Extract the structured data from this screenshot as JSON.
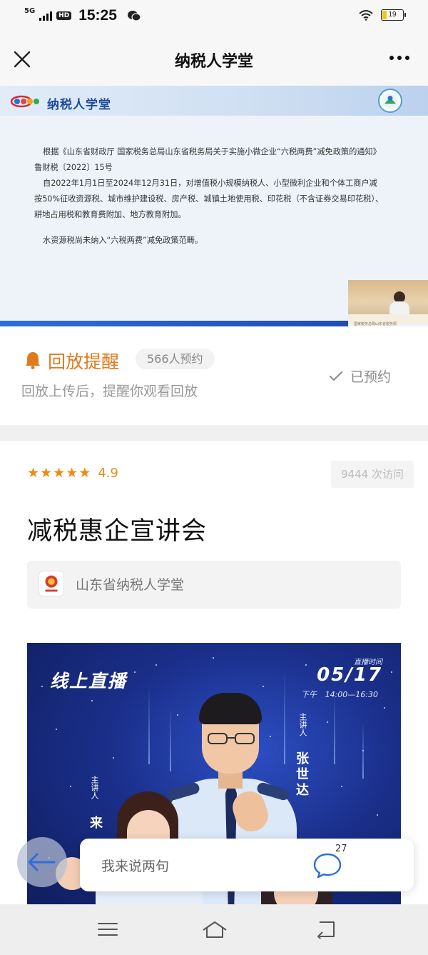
{
  "status_bar": {
    "network": "5G",
    "hd": "HD",
    "time": "15:25",
    "battery": "19",
    "battery_level": 0.19
  },
  "nav": {
    "title": "纳税人学堂"
  },
  "video": {
    "header_title": "纳税人学堂",
    "paragraph1": "根据《山东省财政厅 国家税务总局山东省税务局关于实施小微企业“六税两费”减免政策的通知》鲁财税〔2022〕15号",
    "paragraph2": "自2022年1月1日至2024年12月31日，对增值税小规模纳税人、小型微利企业和个体工商户减按50%征收资源税、城市维护建设税、房产税、城镇土地使用税、印花税（不含证券交易印花税）、耕地占用税和教育费附加、地方教育附加。",
    "paragraph3": "水资源税尚未纳入“六税两费”减免政策范畴。",
    "pip_caption": "国家税务总局山东省税务局"
  },
  "replay": {
    "title": "回放提醒",
    "count": "566人预约",
    "description": "回放上传后，提醒你观看回放",
    "reserved": "已预约"
  },
  "info": {
    "rating": "4.9",
    "rating_stars": 5,
    "visits": "9444 次访问",
    "title": "减税惠企宣讲会",
    "org": "山东省纳税人学堂"
  },
  "poster": {
    "live_label": "线上直播",
    "time_label": "直播时间",
    "date": "05/17",
    "period": "下午",
    "time_range": "14:00—16:30",
    "speaker1_role": "主讲人",
    "speaker1_name": "张世达",
    "speaker2_role": "主讲人",
    "speaker2_name": "来"
  },
  "comment": {
    "placeholder": "我来说两句",
    "count": "27"
  },
  "icons": {
    "close": "close-icon",
    "more": "more-icon",
    "bell": "bell-icon",
    "check": "check-icon",
    "star": "star-icon",
    "back": "back-arrow-icon",
    "comment": "comment-bubble-icon",
    "menu": "menu-icon",
    "home": "home-icon",
    "return": "return-icon"
  },
  "colors": {
    "accent": "#e07a1e",
    "star": "#f08a16",
    "poster_bg": "#1a2f8a",
    "video_bar": "#2d6ed8"
  }
}
